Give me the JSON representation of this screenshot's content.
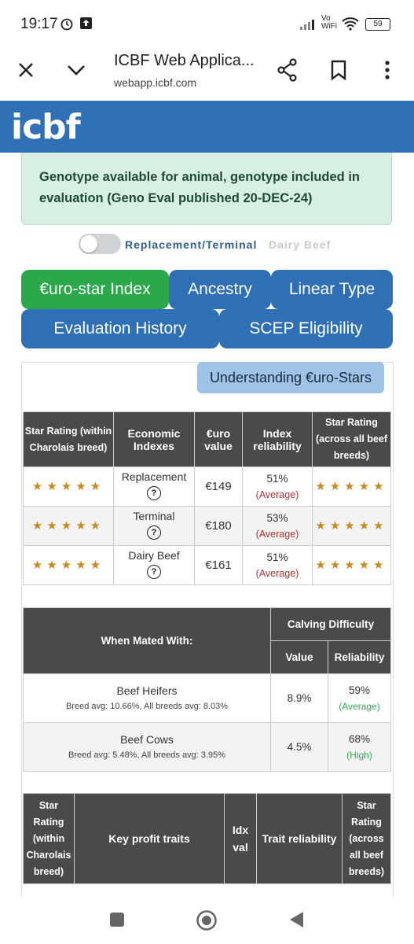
{
  "status_bar": {
    "time": "19:17",
    "network": "Vo WiFi",
    "battery": "59"
  },
  "browser": {
    "title": "ICBF Web Applica...",
    "url": "webapp.icbf.com"
  },
  "brand": {
    "logo": "icbf"
  },
  "notice": {
    "text": "Genotype available for animal, genotype included in evaluation (Geno Eval published 20-DEC-24)"
  },
  "toggle": {
    "label_active": "Replacement/Terminal",
    "label_inactive": "Dairy Beef"
  },
  "tabs": [
    {
      "label": "€uro-star Index"
    },
    {
      "label": "Ancestry"
    },
    {
      "label": "Linear Type"
    },
    {
      "label": "Evaluation History"
    },
    {
      "label": "SCEP Eligibility"
    }
  ],
  "understanding_button": "Understanding €uro-Stars",
  "index_table": {
    "headers": [
      "Star Rating (within Charolais breed)",
      "Economic Indexes",
      "€uro value",
      "Index reliability",
      "Star Rating (across all beef breeds)"
    ],
    "rows": [
      {
        "stars_within": "★★★★★",
        "index": "Replacement",
        "value": "€149",
        "reliability": "51%",
        "reliability_label": "(Average)",
        "stars_across": "★★★★★"
      },
      {
        "stars_within": "★★★★★",
        "index": "Terminal",
        "value": "€180",
        "reliability": "53%",
        "reliability_label": "(Average)",
        "stars_across": "★★★★★"
      },
      {
        "stars_within": "★★★★★",
        "index": "Dairy Beef",
        "value": "€161",
        "reliability": "51%",
        "reliability_label": "(Average)",
        "stars_across": "★★★★★"
      }
    ]
  },
  "calving_table": {
    "header_mated": "When Mated With:",
    "header_group": "Calving Difficulty",
    "header_value": "Value",
    "header_reliability": "Reliability",
    "rows": [
      {
        "title": "Beef Heifers",
        "avg": "Breed avg: 10.66%, All breeds avg: 8.03%",
        "value": "8.9%",
        "reliability": "59%",
        "reliability_label": "(Average)"
      },
      {
        "title": "Beef Cows",
        "avg": "Breed avg: 5.48%, All breeds avg: 3.95%",
        "value": "4.5%",
        "reliability": "68%",
        "reliability_label": "(High)"
      }
    ]
  },
  "traits_table": {
    "headers": [
      "Star Rating (within Charolais breed)",
      "Key profit traits",
      "Idx val",
      "Trait reliability",
      "Star Rating (across all beef breeds)"
    ]
  },
  "colors": {
    "brand_blue": "#2e6fb5",
    "tab_green": "#2aa84a",
    "notice_bg": "#d8efe4",
    "star": "#c8891e",
    "header_dark": "#4a4a4a"
  },
  "icons": [
    "close-icon",
    "chevron-down-icon",
    "share-icon",
    "bookmark-icon",
    "more-vert-icon",
    "help-icon",
    "nav-recents-icon",
    "nav-home-icon",
    "nav-back-icon"
  ]
}
